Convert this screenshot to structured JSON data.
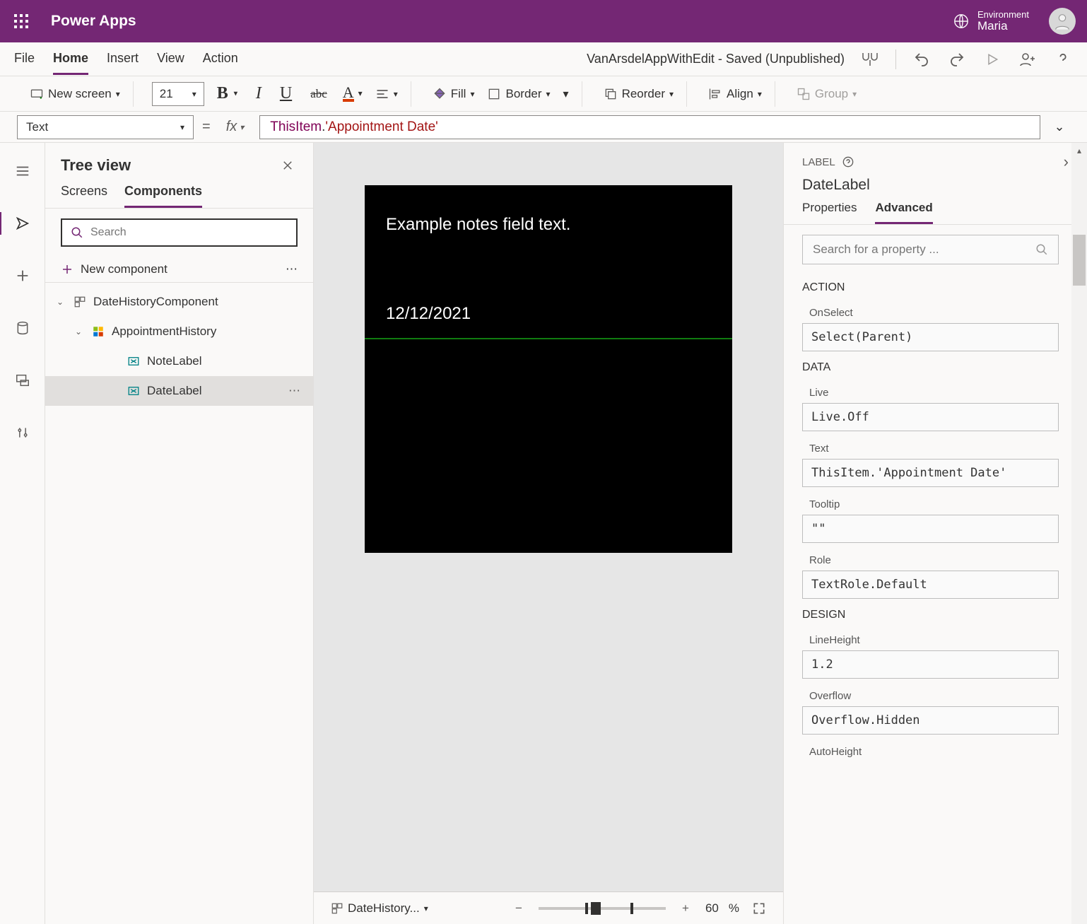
{
  "header": {
    "brand": "Power Apps",
    "env_label": "Environment",
    "env_name": "Maria"
  },
  "menu": {
    "items": [
      "File",
      "Home",
      "Insert",
      "View",
      "Action"
    ],
    "active": "Home",
    "app_title": "VanArsdelAppWithEdit - Saved (Unpublished)"
  },
  "ribbon": {
    "new_screen": "New screen",
    "font_size": "21",
    "fill": "Fill",
    "border": "Border",
    "reorder": "Reorder",
    "align": "Align",
    "group": "Group"
  },
  "formula": {
    "property": "Text",
    "value_this": "ThisItem",
    "value_dot": ".",
    "value_prop": "'Appointment Date'"
  },
  "tree": {
    "title": "Tree view",
    "tabs": [
      "Screens",
      "Components"
    ],
    "active_tab": "Components",
    "search_placeholder": "Search",
    "new_component": "New component",
    "nodes": {
      "comp": "DateHistoryComponent",
      "gallery": "AppointmentHistory",
      "note": "NoteLabel",
      "date": "DateLabel"
    }
  },
  "canvas": {
    "notes_text": "Example notes field text.",
    "date_text": "12/12/2021"
  },
  "status": {
    "breadcrumb": "DateHistory...",
    "zoom_value": "60",
    "zoom_suffix": "%"
  },
  "props": {
    "type_label": "LABEL",
    "control_name": "DateLabel",
    "tabs": [
      "Properties",
      "Advanced"
    ],
    "active_tab": "Advanced",
    "search_placeholder": "Search for a property ...",
    "sections": {
      "action": "ACTION",
      "data": "DATA",
      "design": "DESIGN"
    },
    "fields": {
      "OnSelect": {
        "label": "OnSelect",
        "value": "Select(Parent)"
      },
      "Live": {
        "label": "Live",
        "value": "Live.Off"
      },
      "Text": {
        "label": "Text",
        "value": "ThisItem.'Appointment Date'"
      },
      "Tooltip": {
        "label": "Tooltip",
        "value": "\"\""
      },
      "Role": {
        "label": "Role",
        "value": "TextRole.Default"
      },
      "LineHeight": {
        "label": "LineHeight",
        "value": "1.2"
      },
      "Overflow": {
        "label": "Overflow",
        "value": "Overflow.Hidden"
      },
      "AutoHeight": {
        "label": "AutoHeight",
        "value": ""
      }
    }
  }
}
